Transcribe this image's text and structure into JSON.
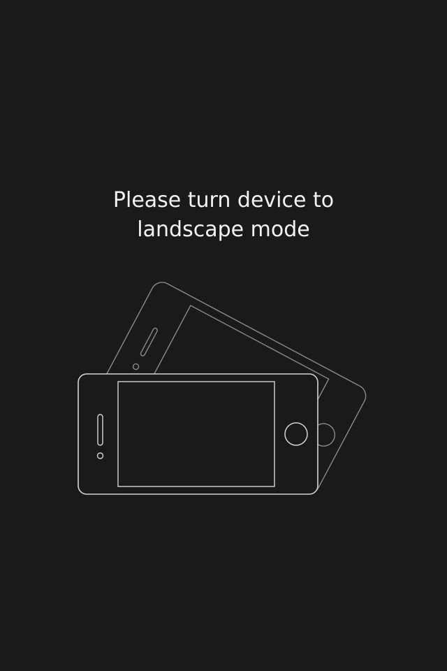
{
  "overlay": {
    "message_line1": "Please turn device to",
    "message_line2": "landscape mode",
    "text_color": "#f2f2f2",
    "background_color": "#1b1a1b",
    "line_color": "#cfcfcf"
  },
  "illustration": {
    "icon": "rotate-device-icon"
  }
}
